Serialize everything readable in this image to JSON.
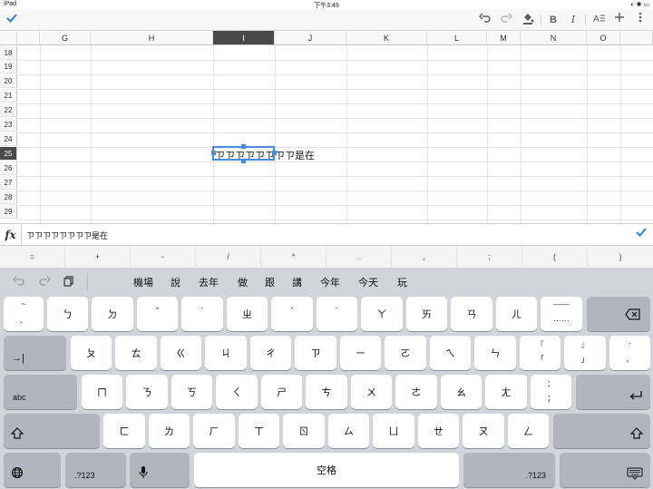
{
  "status_bar": {
    "device": "iPad",
    "time": "下午3:49",
    "right_icons": "◐ ✱ ▭"
  },
  "toolbar": {
    "done_icon": "check-icon",
    "undo_icon": "undo-icon",
    "redo_icon": "redo-icon",
    "fill_icon": "fill-color-icon",
    "bold_label": "B",
    "italic_label": "I",
    "text_format_icon": "text-format-icon",
    "add_icon": "plus-icon",
    "more_icon": "more-icon",
    "accent_color": "#2f7de1"
  },
  "grid": {
    "columns": [
      "G",
      "H",
      "I",
      "J",
      "K",
      "L",
      "M",
      "N",
      "O"
    ],
    "selected_column": "I",
    "rows": [
      "18",
      "19",
      "20",
      "21",
      "22",
      "23",
      "24",
      "25",
      "26",
      "27",
      "28",
      "29"
    ],
    "selected_row": "25",
    "cell_text": "ㄗㄗㄗㄗㄗㄗㄗㄗ是在"
  },
  "formula_bar": {
    "fx_label": "fx",
    "value": "ㄗㄗㄗㄗㄗㄗㄗㄗ是在"
  },
  "symbol_row": [
    "=",
    "+",
    "-",
    "/",
    "*",
    ".",
    ",",
    ";",
    "(",
    ")"
  ],
  "candidates": [
    "機場",
    "說",
    "去年",
    "做",
    "跟",
    "講",
    "今年",
    "今天",
    "玩"
  ],
  "keyboard": {
    "row1": [
      {
        "top": "~",
        "bot": "、"
      },
      {
        "main": "ㄅ"
      },
      {
        "main": "ㄉ"
      },
      {
        "main": "ˇ"
      },
      {
        "main": "ˋ"
      },
      {
        "main": "ㄓ"
      },
      {
        "main": "ˊ"
      },
      {
        "main": "˙"
      },
      {
        "main": "ㄚ"
      },
      {
        "main": "ㄞ"
      },
      {
        "main": "ㄢ"
      },
      {
        "main": "ㄦ"
      },
      {
        "top": "——",
        "bot": "……"
      }
    ],
    "row2": [
      {
        "main": "ㄆ"
      },
      {
        "main": "ㄊ"
      },
      {
        "main": "ㄍ"
      },
      {
        "main": "ㄐ"
      },
      {
        "main": "ㄔ"
      },
      {
        "main": "ㄗ"
      },
      {
        "main": "ㄧ"
      },
      {
        "main": "ㄛ"
      },
      {
        "main": "ㄟ"
      },
      {
        "main": "ㄣ"
      },
      {
        "top": "『",
        "bot": "「"
      },
      {
        "top": "』",
        "bot": "」"
      },
      {
        "top": "·",
        "bot": "、"
      }
    ],
    "row3": [
      {
        "main": "ㄇ"
      },
      {
        "main": "ㄋ"
      },
      {
        "main": "ㄎ"
      },
      {
        "main": "ㄑ"
      },
      {
        "main": "ㄕ"
      },
      {
        "main": "ㄘ"
      },
      {
        "main": "ㄨ"
      },
      {
        "main": "ㄜ"
      },
      {
        "main": "ㄠ"
      },
      {
        "main": "ㄤ"
      },
      {
        "top": "：",
        "bot": "；"
      }
    ],
    "row4": [
      {
        "main": "ㄈ"
      },
      {
        "main": "ㄌ"
      },
      {
        "main": "ㄏ"
      },
      {
        "main": "ㄒ"
      },
      {
        "main": "ㄖ"
      },
      {
        "main": "ㄙ"
      },
      {
        "main": "ㄩ"
      },
      {
        "main": "ㄝ"
      },
      {
        "main": "ㄡ"
      },
      {
        "main": "ㄥ"
      }
    ],
    "abc_label": "abc",
    "numbers_label": ".?123",
    "space_label": "空格"
  }
}
